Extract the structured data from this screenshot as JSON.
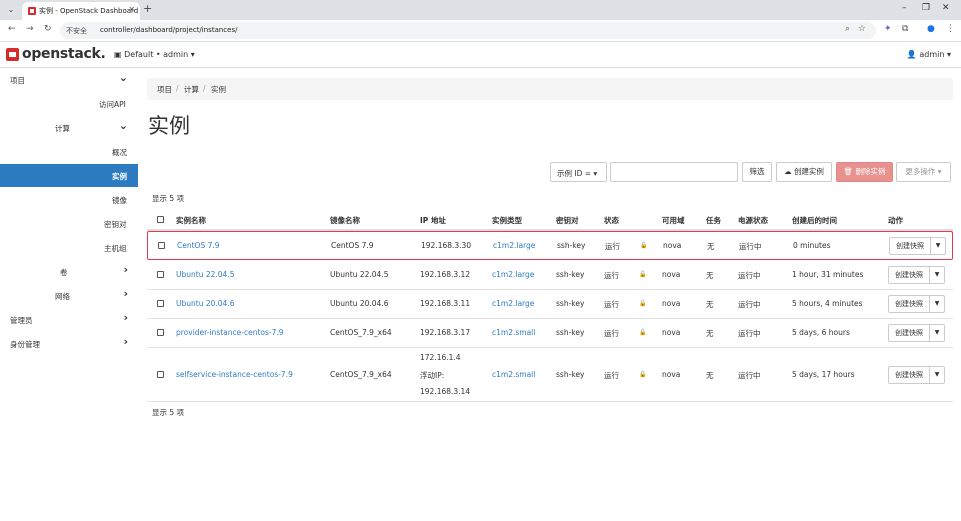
{
  "browser": {
    "tab_title": "实例 - OpenStack Dashboard",
    "security_label": "不安全",
    "url": "controller/dashboard/project/instances/"
  },
  "header": {
    "logo_text": "openstack.",
    "project_selector": "Default • admin ▾",
    "user_menu": "admin ▾"
  },
  "sidebar": {
    "items": [
      {
        "label": "项目"
      },
      {
        "label": "访问API"
      },
      {
        "label": "计算"
      },
      {
        "label": "概况"
      },
      {
        "label": "实例"
      },
      {
        "label": "镜像"
      },
      {
        "label": "密钥对"
      },
      {
        "label": "主机组"
      },
      {
        "label": "卷"
      },
      {
        "label": "网络"
      },
      {
        "label": "管理员"
      },
      {
        "label": "身份管理"
      }
    ]
  },
  "breadcrumb": [
    "项目",
    "计算",
    "实例"
  ],
  "page_title": "实例",
  "filter": {
    "select_label": "示例 ID = ▾",
    "filter_button": "筛选",
    "create_button": "创建实例",
    "delete_button": "删除实例",
    "more_button": "更多操作 ▾"
  },
  "count_text": "显示 5 项",
  "table": {
    "headers": [
      "实例名称",
      "镜像名称",
      "IP 地址",
      "实例类型",
      "密钥对",
      "状态",
      "可用域",
      "任务",
      "电源状态",
      "创建后的时间",
      "动作"
    ],
    "rows": [
      {
        "name": "CentOS 7.9",
        "image": "CentOS 7.9",
        "ip": [
          "192.168.3.30"
        ],
        "flavor": "c1m2.large",
        "keypair": "ssh-key",
        "status": "运行",
        "zone": "nova",
        "task": "无",
        "power": "运行中",
        "age": "0 minutes",
        "action": "创建快照"
      },
      {
        "name": "Ubuntu 22.04.5",
        "image": "Ubuntu 22.04.5",
        "ip": [
          "192.168.3.12"
        ],
        "flavor": "c1m2.large",
        "keypair": "ssh-key",
        "status": "运行",
        "zone": "nova",
        "task": "无",
        "power": "运行中",
        "age": "1 hour, 31 minutes",
        "action": "创建快照"
      },
      {
        "name": "Ubuntu 20.04.6",
        "image": "Ubuntu 20.04.6",
        "ip": [
          "192.168.3.11"
        ],
        "flavor": "c1m2.large",
        "keypair": "ssh-key",
        "status": "运行",
        "zone": "nova",
        "task": "无",
        "power": "运行中",
        "age": "5 hours, 4 minutes",
        "action": "创建快照"
      },
      {
        "name": "provider-instance-centos-7.9",
        "image": "CentOS_7.9_x64",
        "ip": [
          "192.168.3.17"
        ],
        "flavor": "c1m2.small",
        "keypair": "ssh-key",
        "status": "运行",
        "zone": "nova",
        "task": "无",
        "power": "运行中",
        "age": "5 days, 6 hours",
        "action": "创建快照"
      },
      {
        "name": "selfservice-instance-centos-7.9",
        "image": "CentOS_7.9_x64",
        "ip": [
          "172.16.1.4",
          "浮动IP:",
          "192.168.3.14"
        ],
        "flavor": "c1m2.small",
        "keypair": "ssh-key",
        "status": "运行",
        "zone": "nova",
        "task": "无",
        "power": "运行中",
        "age": "5 days, 17 hours",
        "action": "创建快照"
      }
    ]
  },
  "footer_count_text": "显示 5 项"
}
